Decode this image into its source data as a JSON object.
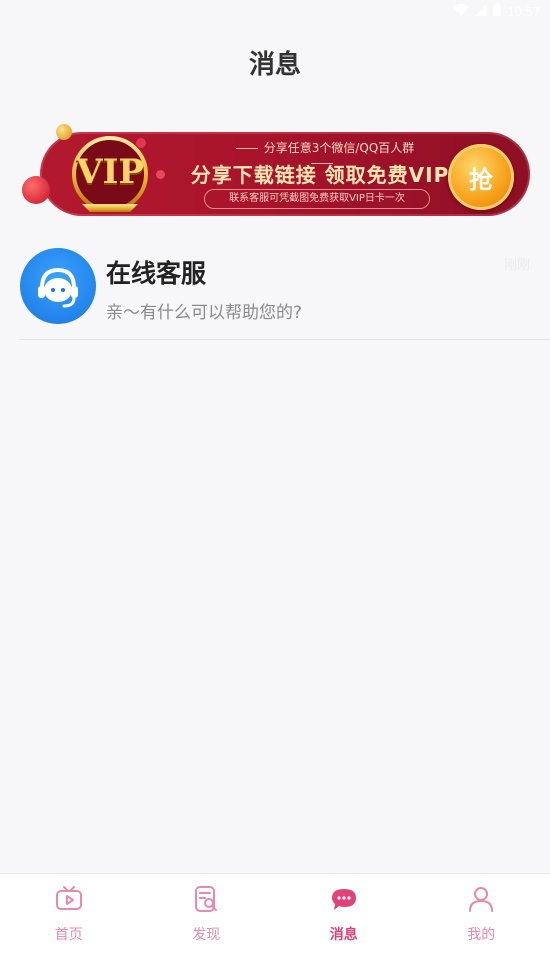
{
  "status_bar": {
    "time": "10:57"
  },
  "header": {
    "title": "消息"
  },
  "banner": {
    "badge_text": "VIP",
    "line1": "分享任意3个微信/QQ百人群",
    "line2": "分享下载链接 领取免费VIP",
    "line3": "联系客服可凭截图免费获取VIP日卡一次",
    "button_label": "抢"
  },
  "conversations": [
    {
      "name": "在线客服",
      "last_message": "亲～有什么可以帮助您的?",
      "time": "刚刚"
    }
  ],
  "tab_bar": {
    "tabs": [
      {
        "label": "首页",
        "icon": "tv-icon"
      },
      {
        "label": "发现",
        "icon": "discover-icon"
      },
      {
        "label": "消息",
        "icon": "chat-bubble-icon",
        "active": true
      },
      {
        "label": "我的",
        "icon": "user-icon"
      }
    ]
  },
  "colors": {
    "accent": "#e0427a",
    "banner_red": "#a8142b",
    "button_gold": "#f7a21c"
  }
}
